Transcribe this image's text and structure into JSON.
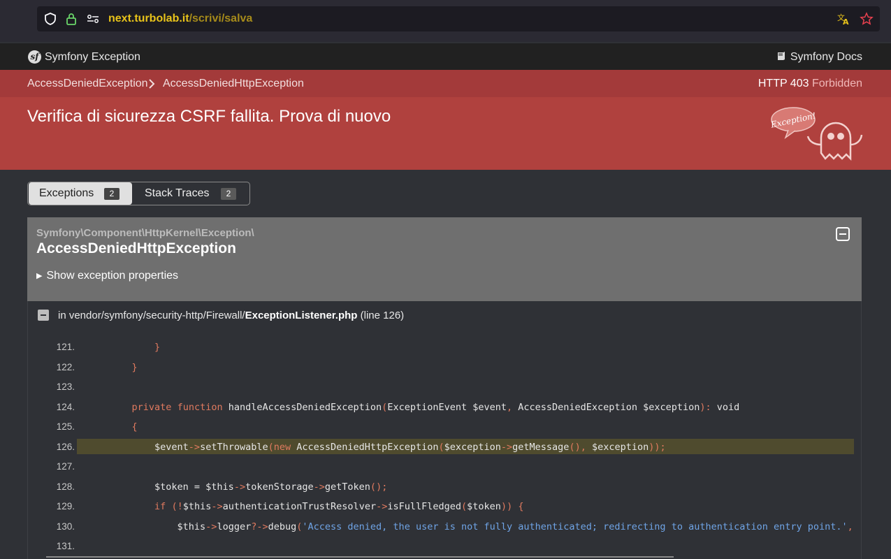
{
  "browser": {
    "url_host": "next.turbolab.it",
    "url_path": "/scrivi/salva"
  },
  "header": {
    "title": "Symfony Exception",
    "docs_label": "Symfony Docs"
  },
  "breadcrumb": {
    "items": [
      "AccessDeniedException",
      "AccessDeniedHttpException"
    ]
  },
  "status": {
    "code": "HTTP 403",
    "text": "Forbidden"
  },
  "message": "Verifica di sicurezza CSRF fallita. Prova di nuovo",
  "ghost_text": "Exception!",
  "tabs": [
    {
      "label": "Exceptions",
      "count": "2"
    },
    {
      "label": "Stack Traces",
      "count": "2"
    }
  ],
  "exception": {
    "namespace": "Symfony\\Component\\HttpKernel\\Exception\\",
    "class": "AccessDeniedHttpException",
    "show_properties": "Show exception properties"
  },
  "trace": {
    "prefix": "in vendor/symfony/security-http/Firewall/",
    "file": "ExceptionListener.php",
    "line_info": "(line 126)",
    "highlight_line": "126.",
    "lines": [
      {
        "num": "121.",
        "code": "        }"
      },
      {
        "num": "122.",
        "code": "    }"
      },
      {
        "num": "123.",
        "code": ""
      },
      {
        "num": "124.",
        "code": "    private function handleAccessDeniedException(ExceptionEvent $event, AccessDeniedException $exception): void"
      },
      {
        "num": "125.",
        "code": "    {"
      },
      {
        "num": "126.",
        "code": "        $event->setThrowable(new AccessDeniedHttpException($exception->getMessage(), $exception));"
      },
      {
        "num": "127.",
        "code": ""
      },
      {
        "num": "128.",
        "code": "        $token = $this->tokenStorage->getToken();"
      },
      {
        "num": "129.",
        "code": "        if (!$this->authenticationTrustResolver->isFullFledged($token)) {"
      },
      {
        "num": "130.",
        "code": "            $this->logger?->debug('Access denied, the user is not fully authenticated; redirecting to authentication entry point.',"
      },
      {
        "num": "131.",
        "code": ""
      }
    ]
  },
  "colors": {
    "accent_red": "#b0413e",
    "breadcrumb_red": "#a33a3a",
    "highlight": "#4f4b2e",
    "url_yellow": "#e8c31a"
  }
}
